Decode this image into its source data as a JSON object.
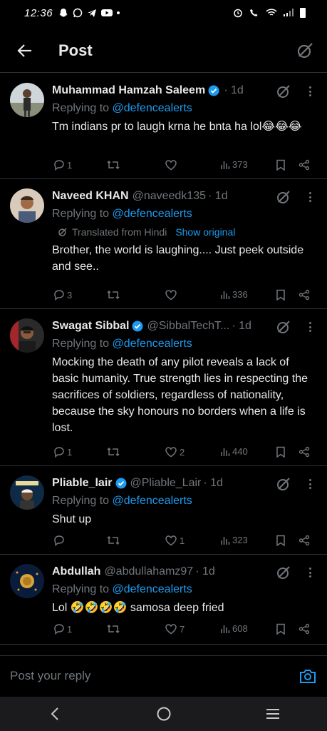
{
  "status_bar": {
    "time": "12:36"
  },
  "header": {
    "title": "Post"
  },
  "posts": [
    {
      "name": "Muhammad Hamzah Saleem",
      "verified": true,
      "handle": "",
      "time": "· 1d",
      "replying_prefix": "Replying to",
      "replying_to": "@defencealerts",
      "text": "Tm indians pr to laugh krna he bnta ha lol😂😂😂",
      "replies": "1",
      "likes": "",
      "views": "373"
    },
    {
      "name": "Naveed KHAN",
      "verified": false,
      "handle": "@naveedk135",
      "time": "· 1d",
      "replying_prefix": "Replying to",
      "replying_to": "@defencealerts",
      "translated_label": "Translated from Hindi",
      "show_original": "Show original",
      "text": "Brother, the world is laughing.... Just peek outside and see..",
      "replies": "3",
      "likes": "",
      "views": "336"
    },
    {
      "name": "Swagat Sibbal",
      "verified": true,
      "handle": "@SibbalTechT...",
      "time": "· 1d",
      "replying_prefix": "Replying to",
      "replying_to": "@defencealerts",
      "text": "Mocking the death of any pilot reveals a lack of basic humanity. True strength lies in respecting the sacrifices of soldiers, regardless of nationality, because the sky honours no borders when a life is lost.",
      "replies": "1",
      "likes": "2",
      "views": "440"
    },
    {
      "name": "Pliable_lair",
      "verified": true,
      "handle": "@Pliable_Lair",
      "time": "· 1d",
      "replying_prefix": "Replying to",
      "replying_to": "@defencealerts",
      "text": "Shut up",
      "replies": "",
      "likes": "1",
      "views": "323"
    },
    {
      "name": "Abdullah",
      "verified": false,
      "handle": "@abdullahamz97",
      "time": "· 1d",
      "replying_prefix": "Replying to",
      "replying_to": "@defencealerts",
      "text": "Lol 🤣🤣🤣🤣 samosa deep fried",
      "replies": "1",
      "likes": "7",
      "views": "608"
    }
  ],
  "reply_bar": {
    "placeholder": "Post your reply"
  },
  "colors": {
    "accent": "#1d9bf0",
    "muted": "#71767b",
    "background": "#000000"
  }
}
